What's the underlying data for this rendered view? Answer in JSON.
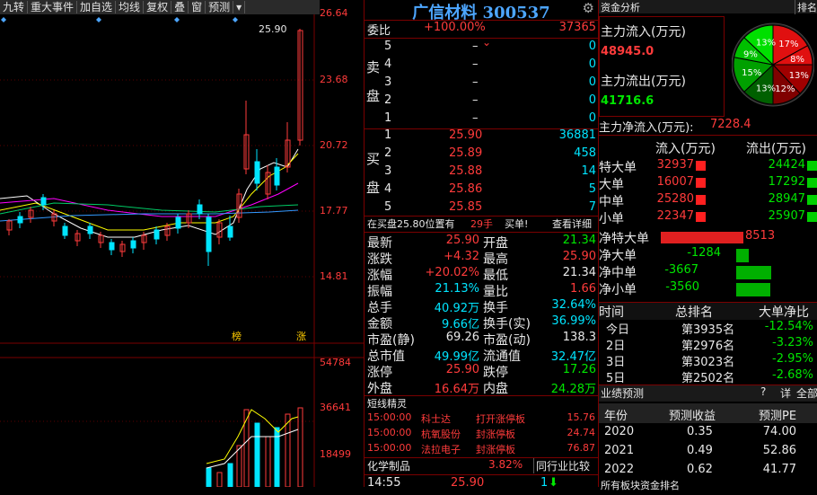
{
  "toolbar": {
    "items": [
      "九转",
      "重大事件",
      "加自选",
      "均线",
      "复权",
      "叠",
      "窗",
      "预测"
    ]
  },
  "chart": {
    "price_axis": [
      "26.64",
      "23.68",
      "20.72",
      "17.77",
      "14.81"
    ],
    "vol_axis": [
      "54784",
      "36641",
      "18499"
    ],
    "max_price_label": "25.90",
    "markers": {
      "bang": "榜",
      "zhang": "涨"
    }
  },
  "quote": {
    "title": "广信材料 300537",
    "weibi": {
      "label": "委比",
      "pct": "+100.00%",
      "value": "37365"
    },
    "sell_label": [
      "卖",
      "盘"
    ],
    "buy_label": [
      "买",
      "盘"
    ],
    "sell": [
      {
        "n": "5",
        "price": "–",
        "vol": "0"
      },
      {
        "n": "4",
        "price": "–",
        "vol": "0"
      },
      {
        "n": "3",
        "price": "–",
        "vol": "0"
      },
      {
        "n": "2",
        "price": "–",
        "vol": "0"
      },
      {
        "n": "1",
        "price": "–",
        "vol": "0"
      }
    ],
    "buy": [
      {
        "n": "1",
        "price": "25.90",
        "vol": "36881"
      },
      {
        "n": "2",
        "price": "25.89",
        "vol": "458"
      },
      {
        "n": "3",
        "price": "25.88",
        "vol": "14"
      },
      {
        "n": "4",
        "price": "25.86",
        "vol": "5"
      },
      {
        "n": "5",
        "price": "25.85",
        "vol": "7"
      }
    ],
    "notice": {
      "text": "在买盘25.80位置有",
      "count": "29手",
      "action": "买单!",
      "link": "查看详细"
    },
    "stats": [
      {
        "l1": "最新",
        "v1": "25.90",
        "l2": "开盘",
        "v2": "21.34"
      },
      {
        "l1": "涨跌",
        "v1": "+4.32",
        "l2": "最高",
        "v2": "25.90"
      },
      {
        "l1": "涨幅",
        "v1": "+20.02%",
        "l2": "最低",
        "v2": "21.34"
      },
      {
        "l1": "振幅",
        "v1": "21.13%",
        "l2": "量比",
        "v2": "1.66"
      },
      {
        "l1": "总手",
        "v1": "40.92万",
        "l2": "换手",
        "v2": "32.64%"
      },
      {
        "l1": "金额",
        "v1": "9.66亿",
        "l2": "换手(实)",
        "v2": "36.99%"
      },
      {
        "l1": "市盈(静)",
        "v1": "69.26",
        "l2": "市盈(动)",
        "v2": "138.3"
      },
      {
        "l1": "总市值",
        "v1": "49.99亿",
        "l2": "流通值",
        "v2": "32.47亿"
      },
      {
        "l1": "涨停",
        "v1": "25.90",
        "l2": "跌停",
        "v2": "17.26"
      },
      {
        "l1": "外盘",
        "v1": "16.64万",
        "l2": "内盘",
        "v2": "24.28万"
      }
    ],
    "short_title": "短线精灵",
    "short_items": [
      {
        "time": "15:00:00",
        "name": "科士达",
        "event": "打开涨停板",
        "val": "15.76"
      },
      {
        "time": "15:00:00",
        "name": "杭氧股份",
        "event": "封涨停板",
        "val": "24.74"
      },
      {
        "time": "15:00:00",
        "name": "法拉电子",
        "event": "封涨停板",
        "val": "76.87"
      }
    ],
    "industry": {
      "name": "化学制品",
      "pct": "3.82%",
      "btn": "同行业比较"
    },
    "tick": {
      "time": "14:55",
      "price": "25.90",
      "vol": "1"
    }
  },
  "fund": {
    "title": "资金分析",
    "tab": "排名",
    "inflow_label": "主力流入(万元)",
    "inflow": "48945.0",
    "outflow_label": "主力流出(万元)",
    "outflow": "41716.6",
    "net_label": "主力净流入(万元):",
    "net": "7228.4",
    "pie_labels": [
      "17%",
      "8%",
      "13%",
      "12%",
      "13%",
      "15%",
      "9%",
      "13%"
    ],
    "hdr_in": "流入(万元)",
    "hdr_out": "流出(万元)",
    "rows": [
      {
        "label": "特大单",
        "in": "32937",
        "out": "24424"
      },
      {
        "label": "大单",
        "in": "16007",
        "out": "17292"
      },
      {
        "label": "中单",
        "in": "25280",
        "out": "28947"
      },
      {
        "label": "小单",
        "in": "22347",
        "out": "25907"
      }
    ],
    "net_rows": [
      {
        "label": "净特大单",
        "value": "8513",
        "frac": 0.66,
        "pos": true
      },
      {
        "label": "净大单",
        "value": "-1284",
        "frac": 0.1,
        "pos": false
      },
      {
        "label": "净中单",
        "value": "-3667",
        "frac": 0.28,
        "pos": false
      },
      {
        "label": "净小单",
        "value": "-3560",
        "frac": 0.27,
        "pos": false
      }
    ],
    "rank_hdr": [
      "时间",
      "总排名",
      "大单净比"
    ],
    "ranks": [
      {
        "t": "今日",
        "r": "第3935名",
        "p": "-12.54%"
      },
      {
        "t": "2日",
        "r": "第2976名",
        "p": "-3.23%"
      },
      {
        "t": "3日",
        "r": "第3023名",
        "p": "-2.95%"
      },
      {
        "t": "5日",
        "r": "第2502名",
        "p": "-2.68%"
      }
    ],
    "forecast_title": "业绩预测",
    "forecast_btns": [
      "?",
      "详",
      "全部"
    ],
    "forecast_hdr": [
      "年份",
      "预测收益",
      "预测PE"
    ],
    "forecast": [
      {
        "y": "2020",
        "e": "0.35",
        "pe": "74.00"
      },
      {
        "y": "2021",
        "e": "0.49",
        "pe": "52.86"
      },
      {
        "y": "2022",
        "e": "0.62",
        "pe": "41.77"
      }
    ],
    "bottom_cut": "所有板块资金排名"
  }
}
